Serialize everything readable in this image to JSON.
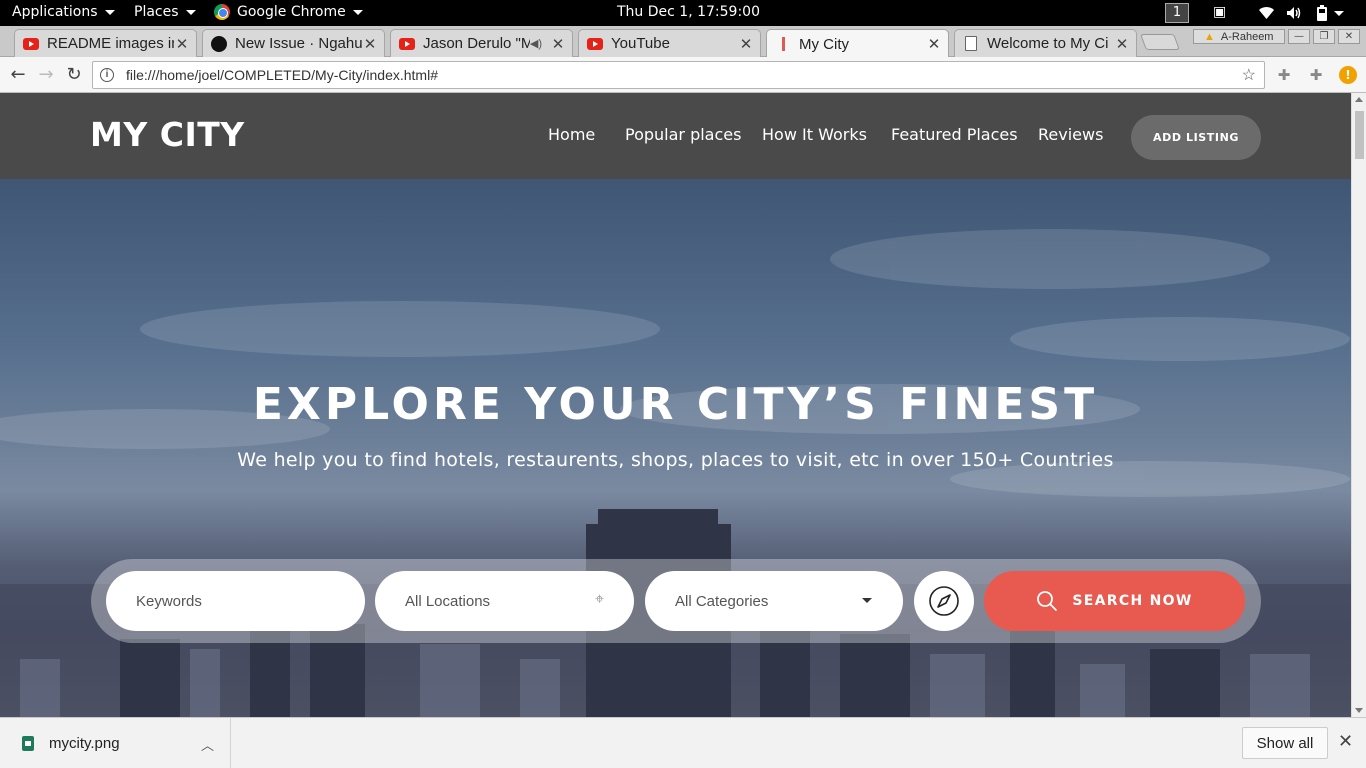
{
  "topbar": {
    "applications": "Applications",
    "places": "Places",
    "browser": "Google Chrome",
    "clock": "Thu Dec  1, 17:59:00",
    "workspace": "1"
  },
  "tabs": [
    {
      "title": "README images in",
      "icon": "youtube-icon"
    },
    {
      "title": "New Issue · Ngahu",
      "icon": "github-icon"
    },
    {
      "title": "Jason Derulo \"M",
      "icon": "youtube-icon",
      "audio": true
    },
    {
      "title": "YouTube",
      "icon": "youtube-icon"
    },
    {
      "title": "My City",
      "icon": "page-icon",
      "active": true
    },
    {
      "title": "Welcome to My Ci",
      "icon": "document-icon"
    }
  ],
  "profile": {
    "name": "A-Raheem"
  },
  "omnibox": {
    "url": "file:///home/joel/COMPLETED/My-City/index.html#"
  },
  "site": {
    "logo": "MY CITY",
    "nav": [
      "Home",
      "Popular places",
      "How It Works",
      "Featured Places",
      "Reviews"
    ],
    "add_listing": "ADD LISTING",
    "hero_title": "EXPLORE YOUR CITY’S FINEST",
    "hero_subtitle": "We help you to find hotels, restaurents, shops, places to visit, etc in over 150+ Countries",
    "search": {
      "keywords_placeholder": "Keywords",
      "location": "All Locations",
      "category": "All Categories",
      "button": "SEARCH NOW"
    }
  },
  "download_shelf": {
    "file": "mycity.png",
    "show_all": "Show all"
  },
  "colors": {
    "header": "#4a4a4a",
    "accent": "#e85a4f",
    "add_listing_bg": "#6b6b6b"
  }
}
